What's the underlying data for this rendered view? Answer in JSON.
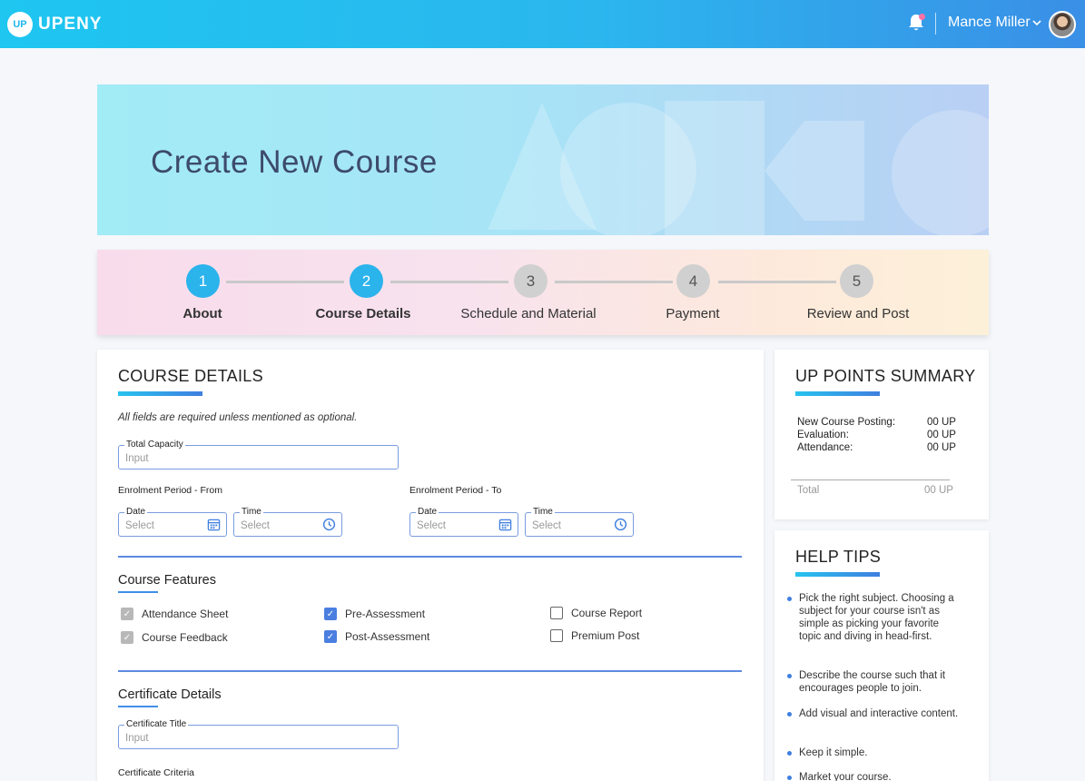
{
  "header": {
    "logo_mark": "UP",
    "logo_text": "UPENY",
    "user_name": "Mance Miller"
  },
  "hero": {
    "title": "Create New Course"
  },
  "stepper": {
    "steps": [
      {
        "number": "1",
        "label": "About",
        "state": "done"
      },
      {
        "number": "2",
        "label": "Course Details",
        "state": "current"
      },
      {
        "number": "3",
        "label": "Schedule and Material",
        "state": "todo"
      },
      {
        "number": "4",
        "label": "Payment",
        "state": "todo"
      },
      {
        "number": "5",
        "label": "Review and Post",
        "state": "todo"
      }
    ]
  },
  "course_details": {
    "title": "COURSE DETAILS",
    "note": "All fields are required unless mentioned as optional.",
    "total_capacity": {
      "label": "Total Capacity",
      "placeholder": "Input"
    },
    "enrolment_from": {
      "label": "Enrolment Period - From",
      "date_label": "Date",
      "date_placeholder": "Select",
      "time_label": "Time",
      "time_placeholder": "Select"
    },
    "enrolment_to": {
      "label": "Enrolment Period - To",
      "date_label": "Date",
      "date_placeholder": "Select",
      "time_label": "Time",
      "time_placeholder": "Select"
    },
    "features": {
      "title": "Course Features",
      "items": [
        {
          "label": "Attendance Sheet",
          "checked": true,
          "locked": true
        },
        {
          "label": "Course Feedback",
          "checked": true,
          "locked": true
        },
        {
          "label": "Pre-Assessment",
          "checked": true,
          "locked": false
        },
        {
          "label": "Post-Assessment",
          "checked": true,
          "locked": false
        },
        {
          "label": "Course Report",
          "checked": false,
          "locked": false
        },
        {
          "label": "Premium Post",
          "checked": false,
          "locked": false
        }
      ]
    },
    "certificate": {
      "title": "Certificate Details",
      "title_field": {
        "label": "Certificate Title",
        "placeholder": "Input"
      },
      "criteria_label": "Certificate Criteria"
    }
  },
  "up_points": {
    "title": "UP POINTS SUMMARY",
    "rows": [
      {
        "label": "New Course Posting:",
        "value": "00 UP"
      },
      {
        "label": "Evaluation:",
        "value": "00 UP"
      },
      {
        "label": "Attendance:",
        "value": "00 UP"
      }
    ],
    "total_label": "Total",
    "total_value": "00 UP"
  },
  "help_tips": {
    "title": "HELP TIPS",
    "tips": [
      "Pick the right subject. Choosing a subject for your course isn't as simple as picking your favorite topic and diving in head-first.",
      "Describe the course such that it encourages people to join.",
      "Add visual and interactive content.",
      "Keep it simple.",
      "Market your course."
    ]
  },
  "colors": {
    "accent": "#2bb3ec",
    "field_border": "#7a9be0",
    "checkbox_blue": "#4a7fe0"
  }
}
